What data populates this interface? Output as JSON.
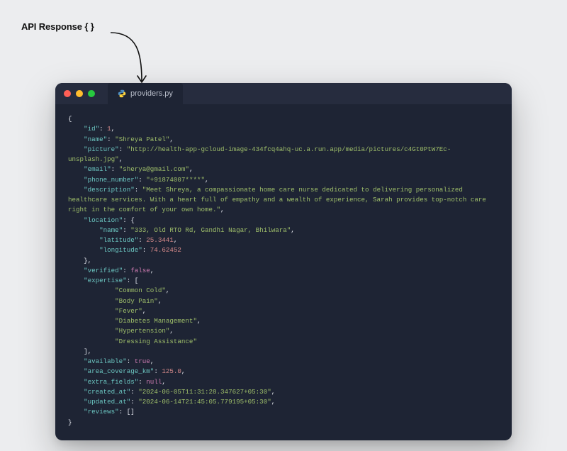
{
  "label": "API Response { }",
  "tab": {
    "filename": "providers.py"
  },
  "code": {
    "open_brace": "{",
    "close_brace": "}",
    "indent1": "    ",
    "indent2": "        ",
    "indent3": "            ",
    "id_key": "\"id\"",
    "id_val": "1",
    "name_key": "\"name\"",
    "name_val": "\"Shreya Patel\"",
    "picture_key": "\"picture\"",
    "picture_val": "\"http://health-app-gcloud-image-434fcq4ahq-uc.a.run.app/media/pictures/c4Gt0PtW7Ec-unsplash.jpg\"",
    "email_key": "\"email\"",
    "email_val": "\"sherya@gmail.com\"",
    "phone_key": "\"phone_number\"",
    "phone_val": "\"+91874007****\"",
    "description_key": "\"description\"",
    "description_val": "\"Meet Shreya, a compassionate home care nurse dedicated to delivering personalized healthcare services. With a heart full of empathy and a wealth of experience, Sarah provides top-notch care right in the comfort of your own home.\"",
    "location_key": "\"location\"",
    "loc_name_key": "\"name\"",
    "loc_name_val": "\"333, Old RTO Rd, Gandhi Nagar, Bhilwara\"",
    "lat_key": "\"latitude\"",
    "lat_val": "25.3441",
    "lon_key": "\"longitude\"",
    "lon_val": "74.62452",
    "verified_key": "\"verified\"",
    "verified_val": "false",
    "expertise_key": "\"expertise\"",
    "exp0": "\"Common Cold\"",
    "exp1": "\"Body Pain\"",
    "exp2": "\"Fever\"",
    "exp3": "\"Diabetes Management\"",
    "exp4": "\"Hypertension\"",
    "exp5": "\"Dressing Assistance\"",
    "available_key": "\"available\"",
    "available_val": "true",
    "area_key": "\"area_coverage_km\"",
    "area_val": "125.0",
    "extra_key": "\"extra_fields\"",
    "extra_val": "null",
    "created_key": "\"created_at\"",
    "created_val": "\"2024-06-05T11:31:28.347627+05:30\"",
    "updated_key": "\"updated_at\"",
    "updated_val": "\"2024-06-14T21:45:05.779195+05:30\"",
    "reviews_key": "\"reviews\"",
    "open_sq": "[",
    "close_sq": "]",
    "colon": ": ",
    "comma": ","
  }
}
